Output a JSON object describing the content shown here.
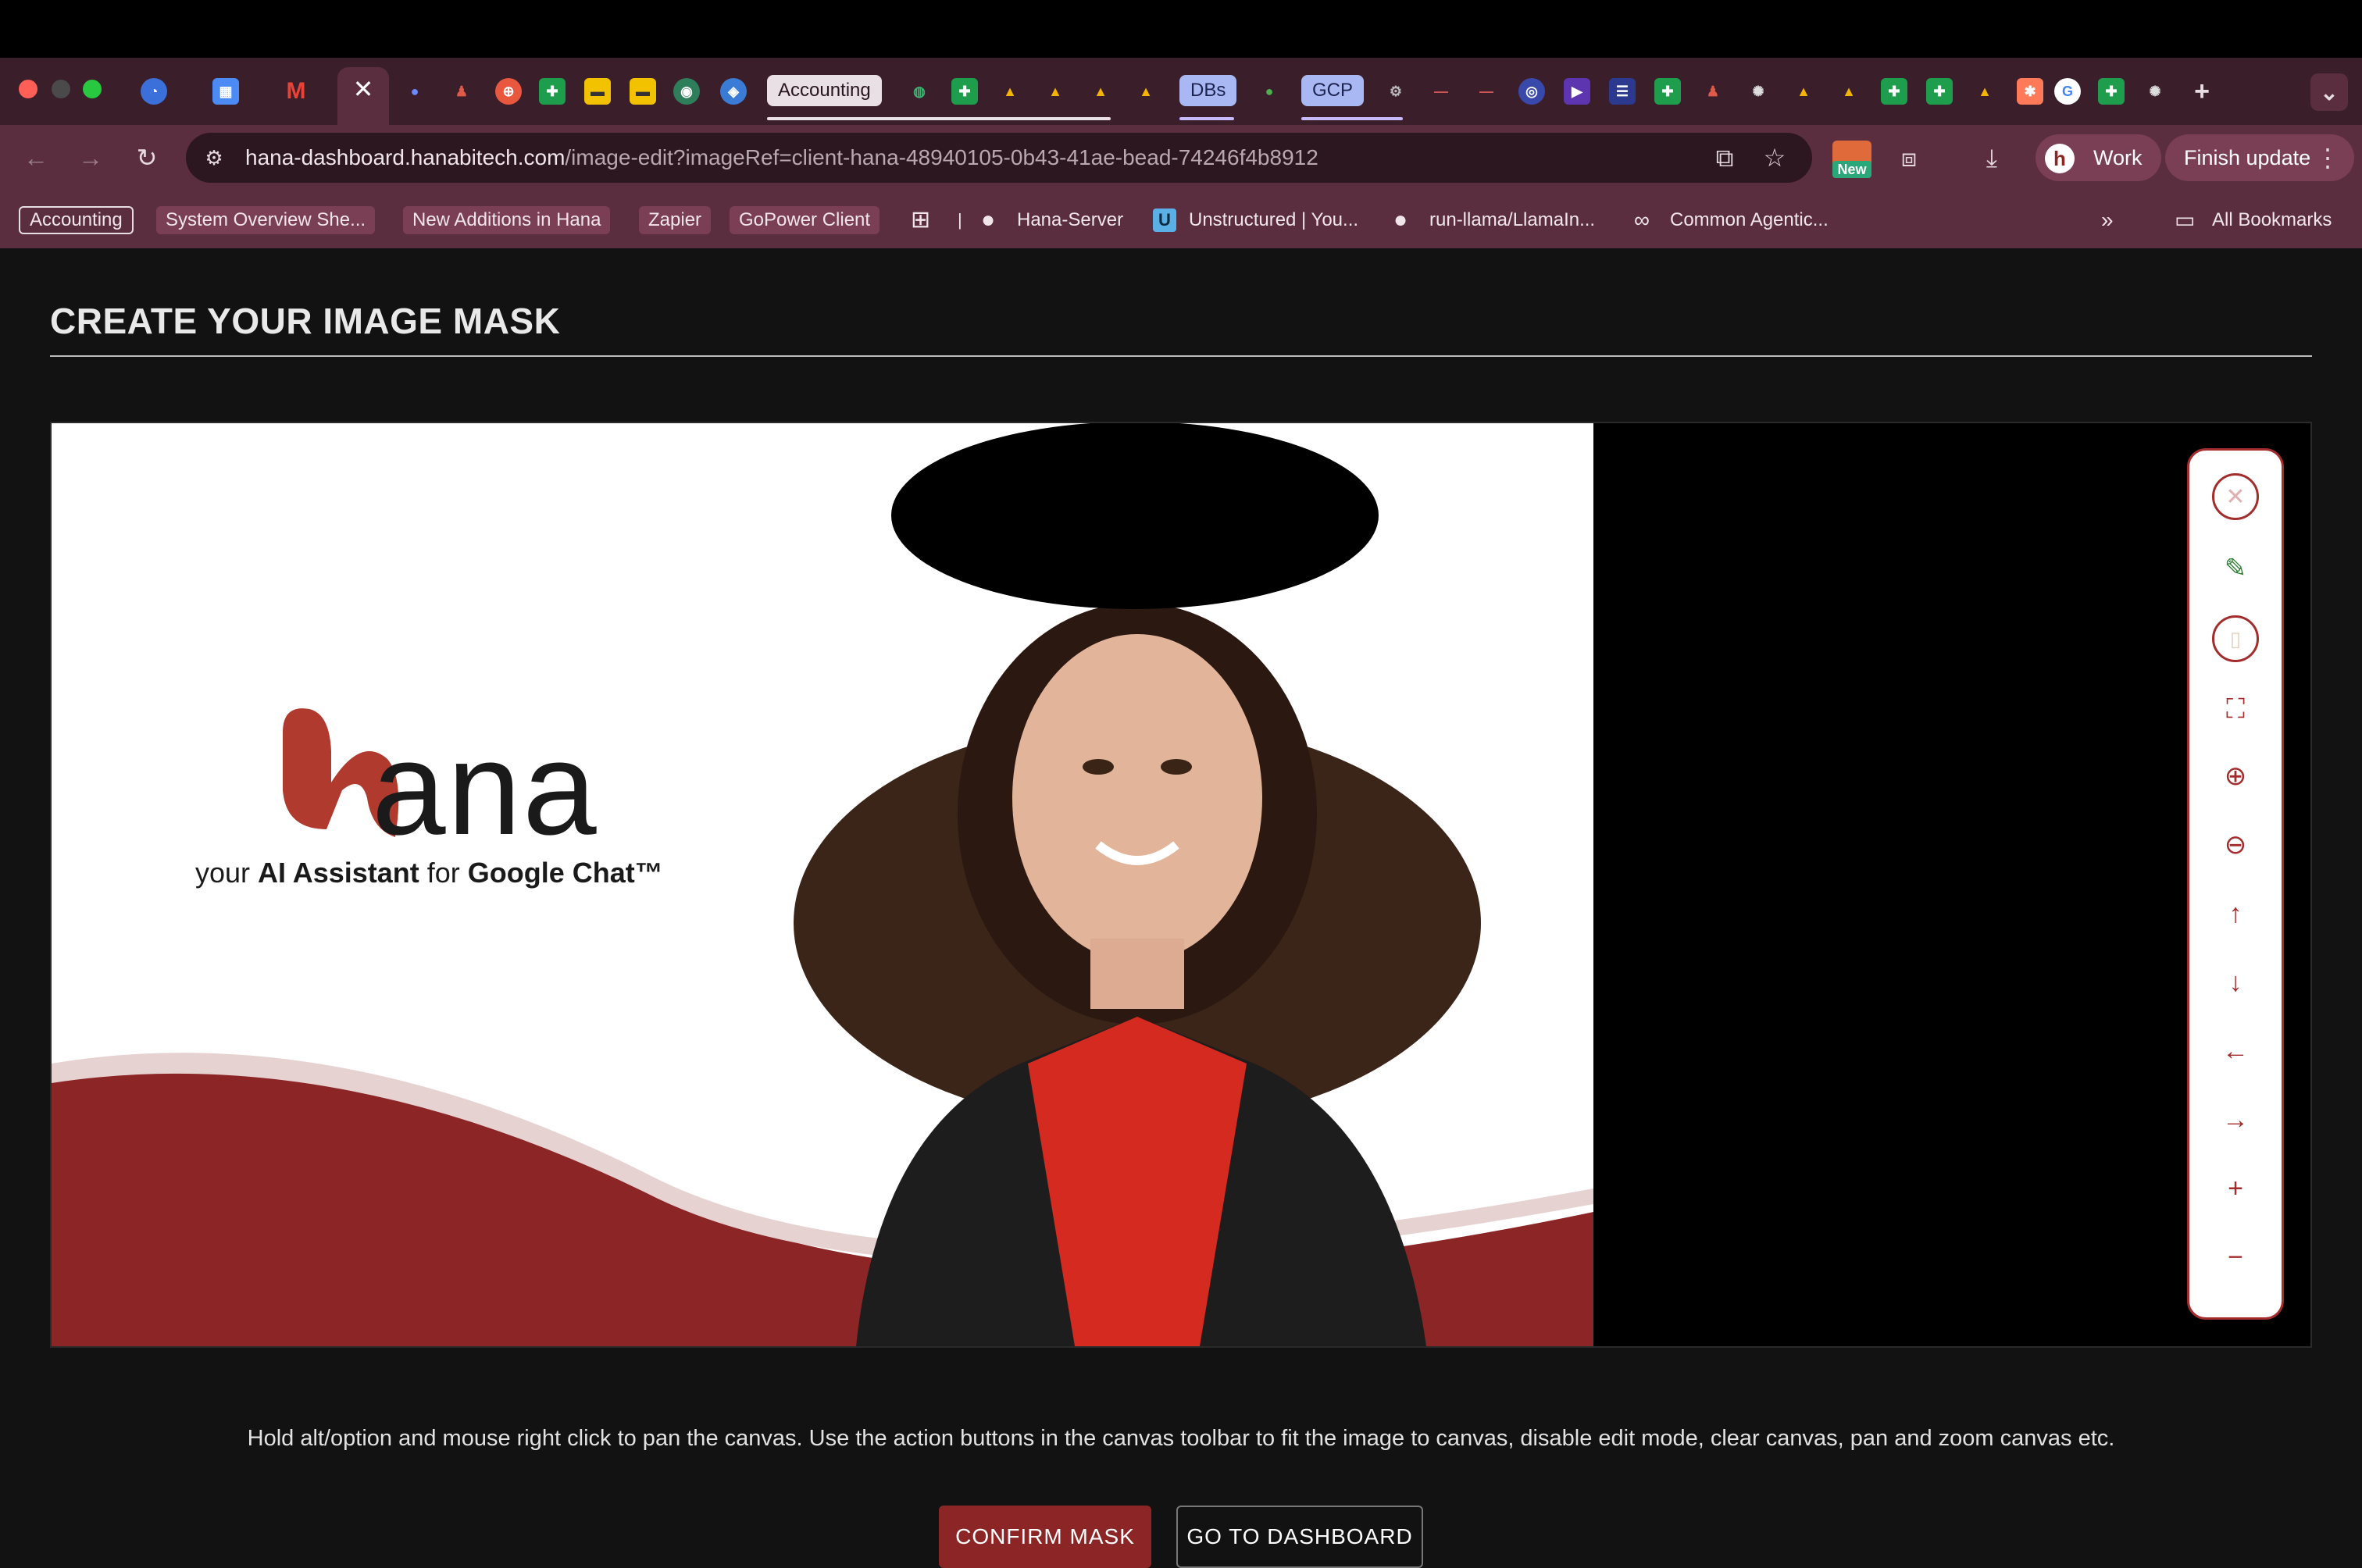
{
  "browser": {
    "tabs": {
      "pill_accounting": "Accounting",
      "pill_dbs": "DBs",
      "pill_gcp": "GCP",
      "active_close": "✕",
      "new_tab": "+",
      "overflow": "⌄"
    },
    "url": {
      "host": "hana-dashboard.hanabitech.com",
      "path": "/image-edit?imageRef=client-hana-48940105-0b43-41ae-bead-74246f4b8912"
    },
    "badge_new": "New",
    "profile_label": "Work",
    "finish_update_label": "Finish update",
    "bookmarks": [
      "Accounting",
      "System Overview She...",
      "New Additions in Hana",
      "Zapier",
      "GoPower Client",
      "Hana-Server",
      "Unstructured | You...",
      "run-llama/LlamaIn...",
      "Common Agentic..."
    ],
    "all_bookmarks": "All Bookmarks"
  },
  "page": {
    "title": "CREATE YOUR IMAGE MASK",
    "image": {
      "brand_word": "ana",
      "brand_initial": "h",
      "tagline_pre": "your ",
      "tagline_b1": "AI Assistant",
      "tagline_mid": " for ",
      "tagline_b2": "Google Chat™"
    },
    "hint": "Hold alt/option and mouse right click to pan the canvas. Use the action buttons in the canvas toolbar to fit the image to canvas, disable edit mode, clear canvas, pan and zoom canvas etc.",
    "confirm_label": "CONFIRM MASK",
    "dashboard_label": "GO TO DASHBOARD"
  },
  "colors": {
    "tab_strip": "#3a1f2b",
    "toolbar": "#5a2e3f",
    "brand_red": "#8c2525",
    "accent_red": "#a32c2c"
  }
}
